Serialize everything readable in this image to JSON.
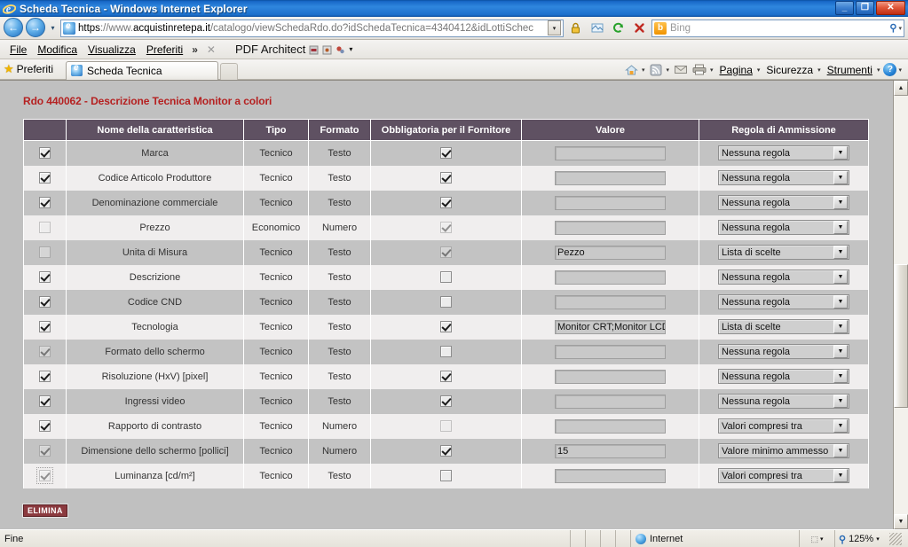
{
  "window": {
    "title": "Scheda Tecnica - Windows Internet Explorer",
    "minimize": "_",
    "maximize": "❐",
    "close": "✕"
  },
  "address_bar": {
    "back_glyph": "←",
    "forward_glyph": "→",
    "history_drop": "▾",
    "url_scheme": "https",
    "url_sep": "://www.",
    "url_host": "acquistinretepa.it",
    "url_path": "/catalogo/viewSchedaRdo.do?idSchedaTecnica=4340412&idLottiSchec",
    "url_full": "https://www.acquistinretepa.it/catalogo/viewSchedaRdo.do?idSchedaTecnica=4340412&idLottiSchec",
    "dropdown_glyph": "▾",
    "lock_glyph": "🔒",
    "compat_glyph": "❐",
    "refresh_glyph": "↻",
    "stop_glyph": "✕"
  },
  "search": {
    "provider": "Bing",
    "provider_initial": "b",
    "magnifier": "⚲",
    "dropdown_glyph": "▾"
  },
  "menu": {
    "items": [
      {
        "label": "File",
        "mnemonic": "F"
      },
      {
        "label": "Modifica",
        "mnemonic": "M"
      },
      {
        "label": "Visualizza",
        "mnemonic": "V"
      },
      {
        "label": "Preferiti",
        "mnemonic": "P"
      }
    ],
    "overflow": "»",
    "close_mark": "✕",
    "pdf_architect": "PDF Architect",
    "pdf_dropdown": "▾"
  },
  "favbar": {
    "favorites_label": "Preferiti",
    "star_glyph": "★"
  },
  "tabs": [
    {
      "label": "Scheda Tecnica",
      "active": true
    }
  ],
  "command_bar": {
    "home_glyph": "⌂",
    "feeds_glyph": "◖",
    "mail_glyph": "✉",
    "print_glyph": "⎙",
    "drop_glyph": "▾",
    "items": [
      {
        "label": "Pagina",
        "mnemonic": "P"
      },
      {
        "label": "Sicurezza",
        "mnemonic": "c"
      },
      {
        "label": "Strumenti",
        "mnemonic": "S"
      }
    ],
    "help_glyph": "?"
  },
  "page": {
    "title": "Rdo 440062 - Descrizione Tecnica Monitor a colori",
    "delete_button": "ELIMINA"
  },
  "table": {
    "headers": [
      "",
      "Nome della caratteristica",
      "Tipo",
      "Formato",
      "Obbligatoria per il Fornitore",
      "Valore",
      "Regola di Ammissione"
    ],
    "rows": [
      {
        "selected": true,
        "selected_dim": false,
        "nome": "Marca",
        "tipo": "Tecnico",
        "formato": "Testo",
        "obbligatoria": true,
        "obbligatoria_dim": false,
        "valore": "",
        "regola": "Nessuna regola"
      },
      {
        "selected": true,
        "selected_dim": false,
        "nome": "Codice Articolo Produttore",
        "tipo": "Tecnico",
        "formato": "Testo",
        "obbligatoria": true,
        "obbligatoria_dim": false,
        "valore": "",
        "regola": "Nessuna regola"
      },
      {
        "selected": true,
        "selected_dim": false,
        "nome": "Denominazione commerciale",
        "tipo": "Tecnico",
        "formato": "Testo",
        "obbligatoria": true,
        "obbligatoria_dim": false,
        "valore": "",
        "regola": "Nessuna regola"
      },
      {
        "selected": false,
        "selected_dim": true,
        "nome": "Prezzo",
        "tipo": "Economico",
        "formato": "Numero",
        "obbligatoria": true,
        "obbligatoria_dim": true,
        "valore": "",
        "regola": "Nessuna regola"
      },
      {
        "selected": false,
        "selected_dim": true,
        "nome": "Unita di Misura",
        "tipo": "Tecnico",
        "formato": "Testo",
        "obbligatoria": true,
        "obbligatoria_dim": true,
        "valore": "Pezzo",
        "regola": "Lista di scelte"
      },
      {
        "selected": true,
        "selected_dim": false,
        "nome": "Descrizione",
        "tipo": "Tecnico",
        "formato": "Testo",
        "obbligatoria": false,
        "obbligatoria_dim": false,
        "valore": "",
        "regola": "Nessuna regola"
      },
      {
        "selected": true,
        "selected_dim": false,
        "nome": "Codice CND",
        "tipo": "Tecnico",
        "formato": "Testo",
        "obbligatoria": false,
        "obbligatoria_dim": false,
        "valore": "",
        "regola": "Nessuna regola"
      },
      {
        "selected": true,
        "selected_dim": false,
        "nome": "Tecnologia",
        "tipo": "Tecnico",
        "formato": "Testo",
        "obbligatoria": true,
        "obbligatoria_dim": false,
        "valore": "Monitor CRT;Monitor LCD-T",
        "regola": "Lista di scelte"
      },
      {
        "selected": true,
        "selected_dim": true,
        "nome": "Formato dello schermo",
        "tipo": "Tecnico",
        "formato": "Testo",
        "obbligatoria": false,
        "obbligatoria_dim": false,
        "valore": "",
        "regola": "Nessuna regola"
      },
      {
        "selected": true,
        "selected_dim": false,
        "nome": "Risoluzione (HxV) [pixel]",
        "tipo": "Tecnico",
        "formato": "Testo",
        "obbligatoria": true,
        "obbligatoria_dim": false,
        "valore": "",
        "regola": "Nessuna regola"
      },
      {
        "selected": true,
        "selected_dim": false,
        "nome": "Ingressi video",
        "tipo": "Tecnico",
        "formato": "Testo",
        "obbligatoria": true,
        "obbligatoria_dim": false,
        "valore": "",
        "regola": "Nessuna regola"
      },
      {
        "selected": true,
        "selected_dim": false,
        "nome": "Rapporto di contrasto",
        "tipo": "Tecnico",
        "formato": "Numero",
        "obbligatoria": false,
        "obbligatoria_dim": true,
        "valore": "",
        "regola": "Valori compresi tra"
      },
      {
        "selected": true,
        "selected_dim": true,
        "nome": "Dimensione dello schermo [pollici]",
        "tipo": "Tecnico",
        "formato": "Numero",
        "obbligatoria": true,
        "obbligatoria_dim": false,
        "valore": "15",
        "regola": "Valore minimo ammesso"
      },
      {
        "selected": true,
        "selected_dim": true,
        "nome": "Luminanza [cd/m²]",
        "tipo": "Tecnico",
        "formato": "Testo",
        "obbligatoria": false,
        "obbligatoria_dim": false,
        "valore": "",
        "regola": "Valori compresi tra"
      }
    ]
  },
  "scrollbar": {
    "up_glyph": "▲",
    "down_glyph": "▼"
  },
  "status_bar": {
    "message": "Fine",
    "zone": "Internet",
    "protected_glyph": "⬚",
    "protected_drop": "▾",
    "zoom_level": "125%",
    "zoom_drop": "▾"
  },
  "colors": {
    "header_purple": "#5f5162",
    "title_red": "#b52121",
    "row_odd": "#c3c3c3",
    "row_even": "#f0eeee",
    "page_bg": "#c0c0c0",
    "elimina_bg": "#8b3a3f"
  }
}
